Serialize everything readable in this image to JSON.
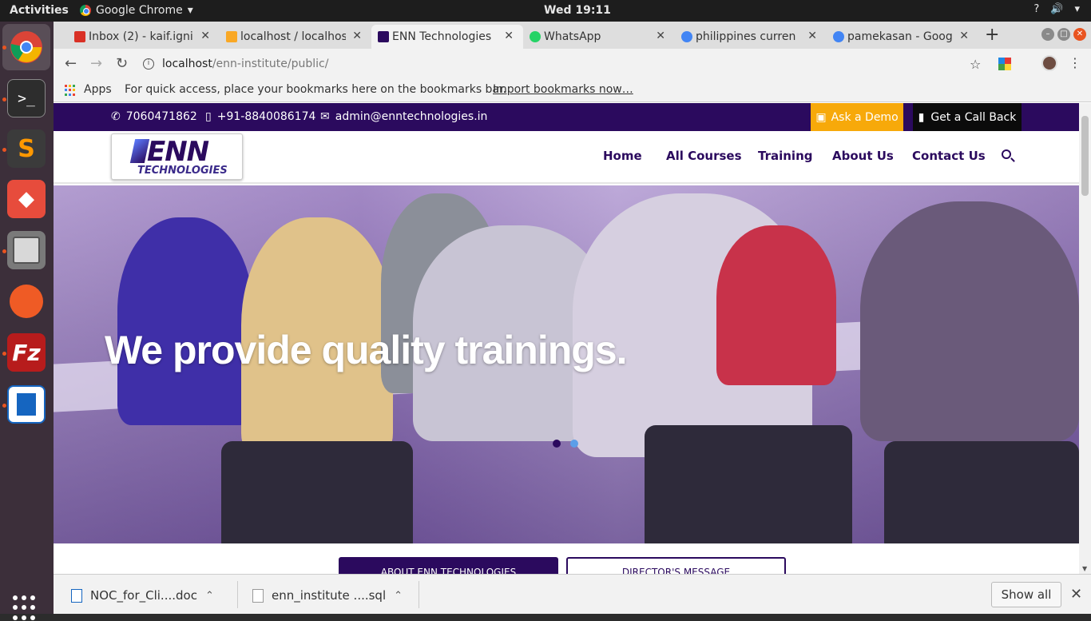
{
  "system": {
    "activities": "Activities",
    "app_menu": "Google Chrome",
    "clock": "Wed 19:11",
    "tray_help": "?",
    "tray_volume": "🔊",
    "tray_menu": "▾"
  },
  "chrome": {
    "tabs": [
      {
        "label": "Inbox (2) - kaif.igni",
        "favicon_color": "#d93025"
      },
      {
        "label": "localhost / localhost",
        "favicon_color": "#f9a825"
      },
      {
        "label": "ENN Technologies",
        "favicon_color": "#2b0a5e"
      },
      {
        "label": "WhatsApp",
        "favicon_color": "#25d366"
      },
      {
        "label": "philippines curren",
        "favicon_color": "#4285f4"
      },
      {
        "label": "pamekasan - Goog",
        "favicon_color": "#4285f4"
      }
    ],
    "url_host": "localhost",
    "url_path": "/enn-institute/public/",
    "bookmarks": {
      "apps": "Apps",
      "hint": "For quick access, place your bookmarks here on the bookmarks bar.",
      "import": "Import bookmarks now…"
    }
  },
  "site": {
    "phone1": "7060471862",
    "phone2": "+91-8840086174",
    "email": "admin@enntechnologies.in",
    "ask_demo": "Ask a Demo",
    "call_back": "Get a Call Back",
    "logo_big": "ENN",
    "logo_small": "TECHNOLOGIES",
    "nav": [
      "Home",
      "All Courses",
      "Training",
      "About Us",
      "Contact Us"
    ],
    "hero_title": "We provide quality trainings.",
    "about_button": "ABOUT ENN TECHNOLOGIES",
    "director_button": "DIRECTOR'S MESSAGE",
    "colors": {
      "brand": "#2b0a5e",
      "accent": "#f7a90a"
    }
  },
  "downloads": {
    "items": [
      "NOC_for_Cli....doc",
      "enn_institute ....sql"
    ],
    "show_all": "Show all"
  }
}
